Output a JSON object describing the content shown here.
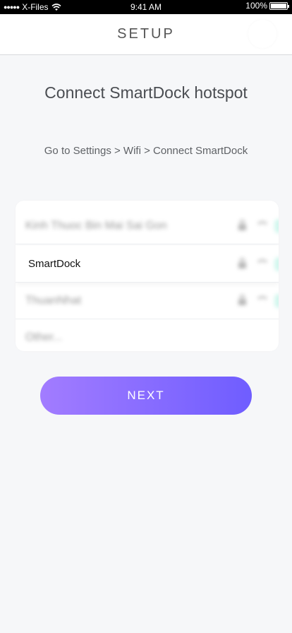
{
  "status_bar": {
    "signal_dots": "●●●●●",
    "carrier": "X-Files",
    "time": "9:41 AM",
    "battery_percent": "100%",
    "battery_level": 1.0
  },
  "header": {
    "title": "SETUP"
  },
  "main": {
    "heading": "Connect SmartDock hotspot",
    "instruction": "Go to Settings > Wifi > Connect SmartDock"
  },
  "wifi_list": {
    "networks": [
      {
        "name": "Kinh Thuoc Bin Mai Sai Gon",
        "locked": true
      },
      {
        "name": "SmartDock",
        "locked": true
      },
      {
        "name": "ThuanNhat",
        "locked": true
      },
      {
        "name": "Other..."
      }
    ]
  },
  "actions": {
    "next_label": "NEXT"
  },
  "colors": {
    "button_gradient_start": "#a27cff",
    "button_gradient_end": "#6f5dff",
    "background": "#f6f7f9"
  },
  "icons": [
    "wifi-icon",
    "lock-icon",
    "info-icon",
    "battery-icon"
  ]
}
